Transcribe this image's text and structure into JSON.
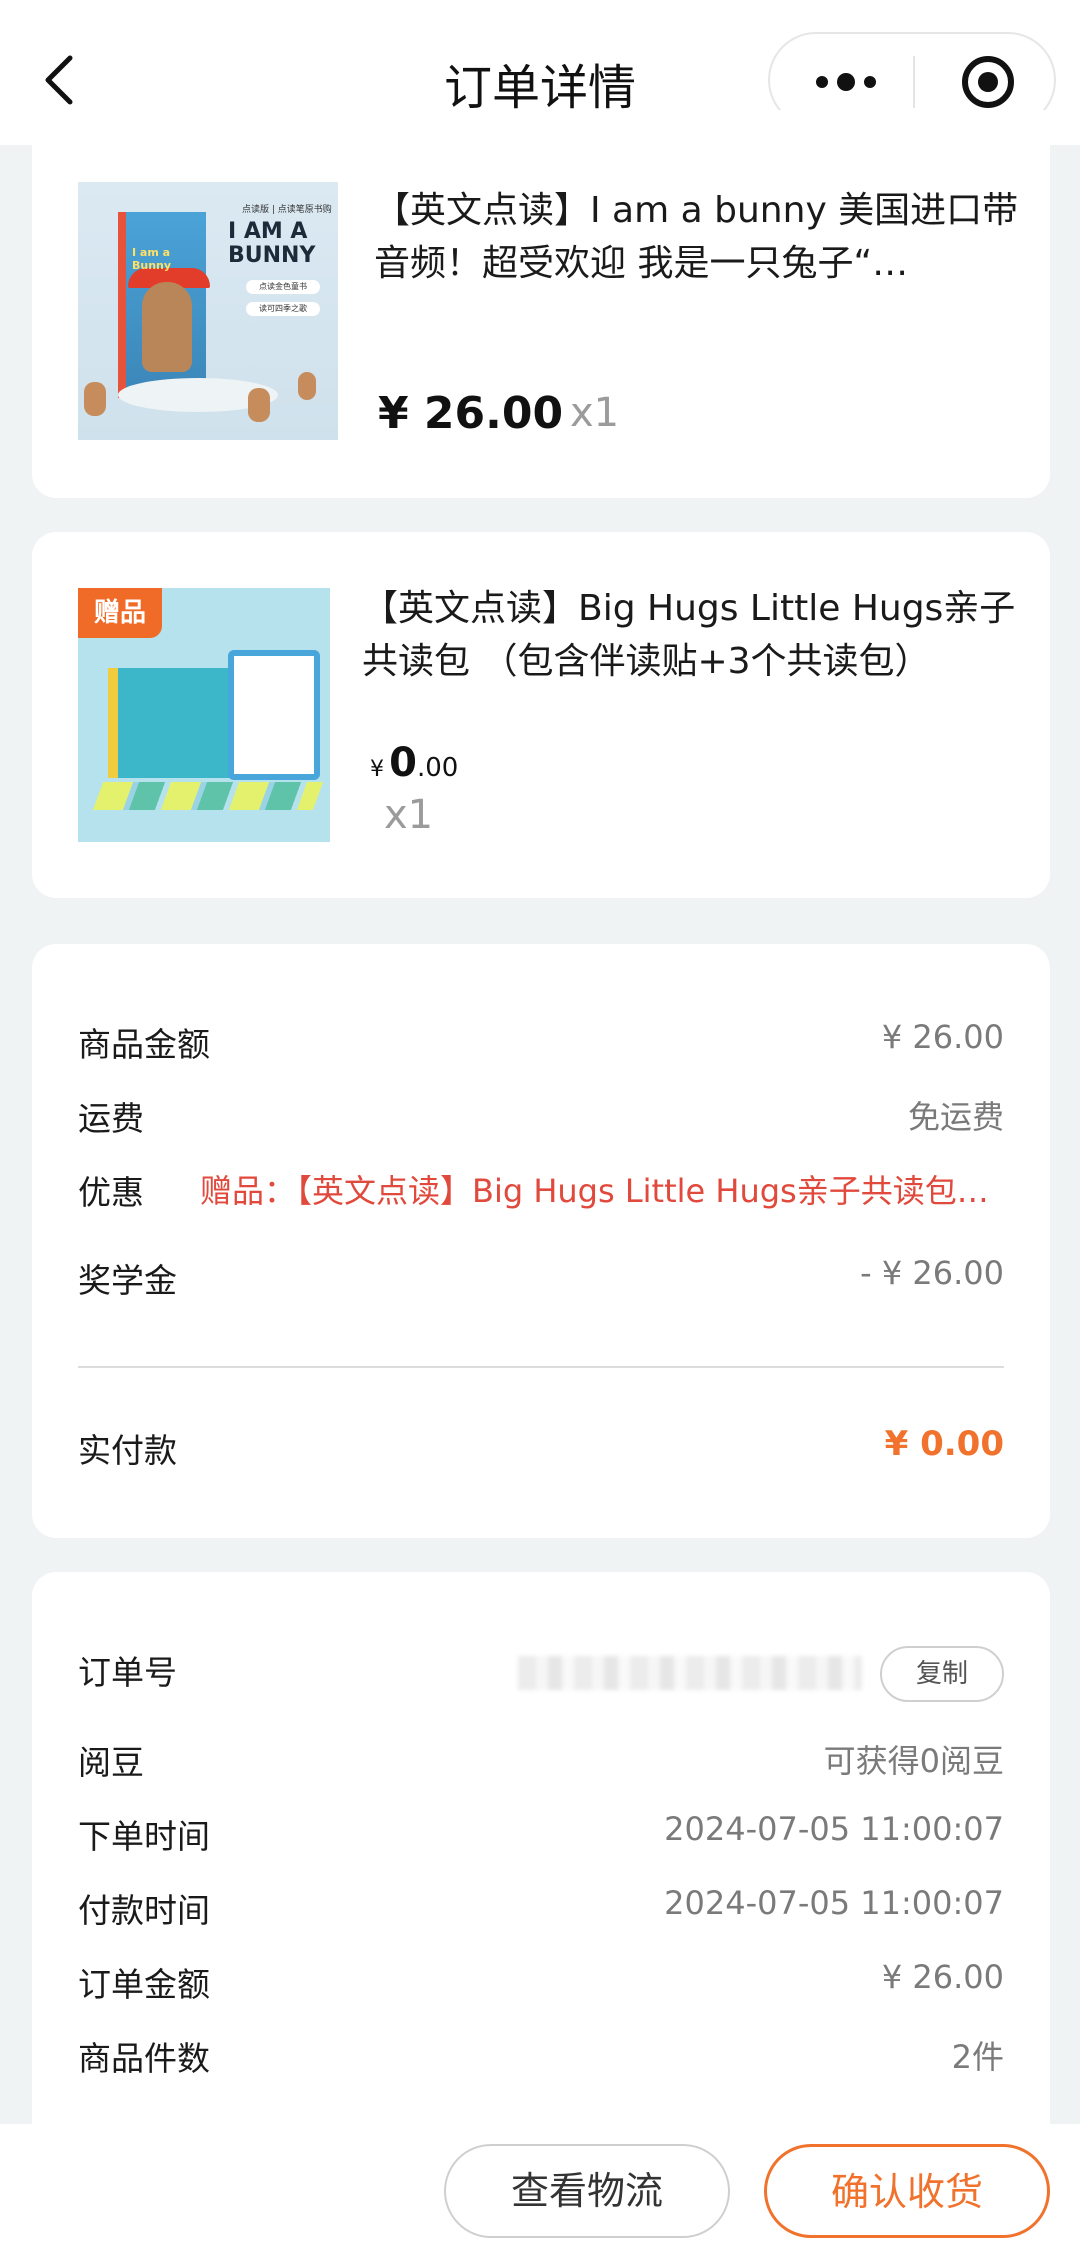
{
  "header": {
    "title": "订单详情",
    "back_icon": "chevron-left-icon",
    "more_icon": "more-dots-icon",
    "close_icon": "target-circle-icon"
  },
  "products": [
    {
      "title": "【英文点读】I am a bunny 美国进口带音频！超受欢迎 我是一只兔子“…",
      "price": "¥ 26.00",
      "qty": "x1",
      "image": {
        "top_small": "点读版 | 点读笔原书购",
        "cover_text": "I am a Bunny",
        "big_title": "I AM A BUNNY",
        "pill1": "点读金色童书",
        "pill2": "读可四季之歌"
      }
    },
    {
      "badge": "赠品",
      "title": "【英文点读】Big Hugs Little Hugs亲子共读包 （包含伴读贴+3个共读包）",
      "price_currency": "¥",
      "price_int": "0",
      "price_dec": ".00",
      "qty": "x1"
    }
  ],
  "summary": {
    "goods_label": "商品金额",
    "goods_value": "¥ 26.00",
    "shipping_label": "运费",
    "shipping_value": "免运费",
    "discount_label": "优惠",
    "discount_value": "赠品：【英文点读】Big Hugs Little Hugs亲子共读包…",
    "scholarship_label": "奖学金",
    "scholarship_value": "- ¥ 26.00",
    "paid_label": "实付款",
    "paid_value": "¥ 0.00"
  },
  "order_info": {
    "order_no_label": "订单号",
    "copy_label": "复制",
    "beans_label": "阅豆",
    "beans_value": "可获得0阅豆",
    "order_time_label": "下单时间",
    "order_time_value": "2024-07-05 11:00:07",
    "pay_time_label": "付款时间",
    "pay_time_value": "2024-07-05 11:00:07",
    "order_amount_label": "订单金额",
    "order_amount_value": "¥ 26.00",
    "count_label": "商品件数",
    "count_value": "2件"
  },
  "actions": {
    "logistics": "查看物流",
    "confirm": "确认收货"
  },
  "colors": {
    "accent": "#f0722c",
    "promo_red": "#e0493b",
    "background": "#eff3f4"
  }
}
